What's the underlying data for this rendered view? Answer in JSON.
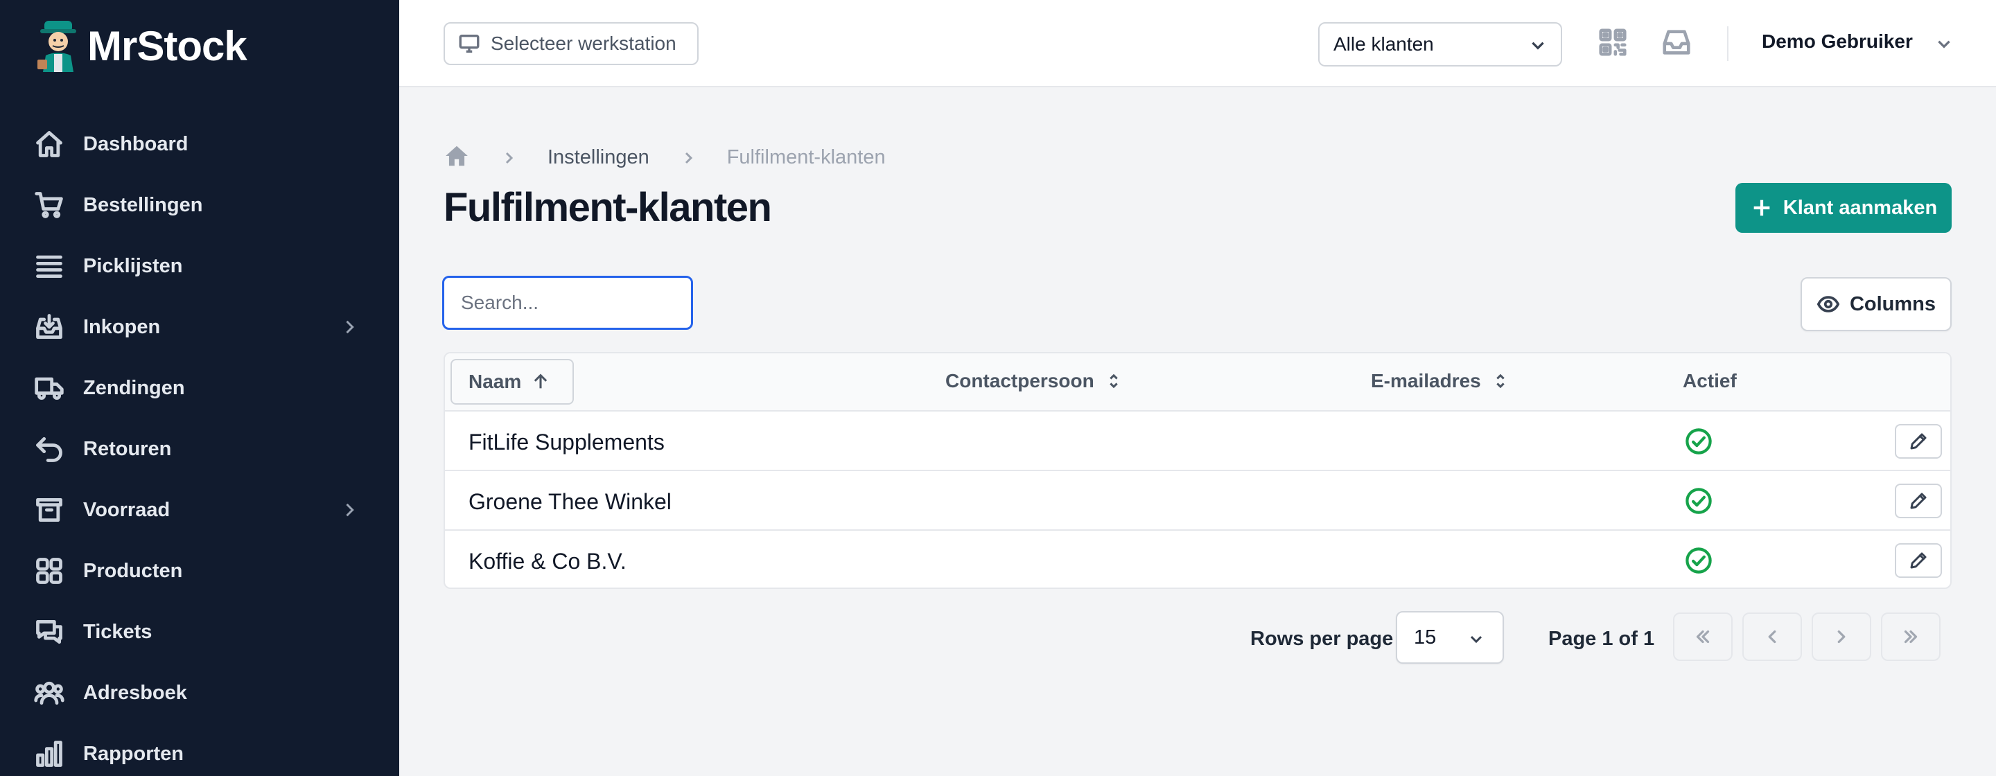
{
  "app": {
    "name": "MrStock"
  },
  "sidebar": {
    "items": [
      {
        "label": "Dashboard",
        "icon": "home-icon",
        "has_submenu": false
      },
      {
        "label": "Bestellingen",
        "icon": "cart-icon",
        "has_submenu": false
      },
      {
        "label": "Picklijsten",
        "icon": "list-icon",
        "has_submenu": false
      },
      {
        "label": "Inkopen",
        "icon": "inbox-download-icon",
        "has_submenu": true
      },
      {
        "label": "Zendingen",
        "icon": "truck-icon",
        "has_submenu": false
      },
      {
        "label": "Retouren",
        "icon": "return-arrow-icon",
        "has_submenu": false
      },
      {
        "label": "Voorraad",
        "icon": "archive-box-icon",
        "has_submenu": true
      },
      {
        "label": "Producten",
        "icon": "grid-icon",
        "has_submenu": false
      },
      {
        "label": "Tickets",
        "icon": "chat-bubbles-icon",
        "has_submenu": false
      },
      {
        "label": "Adresboek",
        "icon": "users-icon",
        "has_submenu": false
      },
      {
        "label": "Rapporten",
        "icon": "bar-chart-icon",
        "has_submenu": false
      }
    ]
  },
  "topbar": {
    "workstation_label": "Selecteer werkstation",
    "client_filter": "Alle klanten",
    "user_name": "Demo Gebruiker",
    "icons": [
      "qr-code-icon",
      "inbox-icon"
    ]
  },
  "breadcrumb": {
    "link": "Instellingen",
    "current": "Fulfilment-klanten"
  },
  "page": {
    "title": "Fulfilment-klanten",
    "create_label": "Klant aanmaken"
  },
  "toolbar": {
    "search_placeholder": "Search...",
    "columns_label": "Columns"
  },
  "table": {
    "headers": {
      "name": "Naam",
      "contact": "Contactpersoon",
      "email": "E-mailadres",
      "active": "Actief"
    },
    "rows": [
      {
        "name": "FitLife Supplements",
        "contact": "",
        "email": "",
        "active": true
      },
      {
        "name": "Groene Thee Winkel",
        "contact": "",
        "email": "",
        "active": true
      },
      {
        "name": "Koffie & Co B.V.",
        "contact": "",
        "email": "",
        "active": true
      }
    ]
  },
  "pagination": {
    "rows_label": "Rows per page",
    "rows_value": "15",
    "page_info": "Page 1 of 1"
  },
  "colors": {
    "sidebar_bg": "#111b2e",
    "accent": "#0d9488",
    "active_green": "#16a34a",
    "focus_blue": "#2563eb"
  }
}
